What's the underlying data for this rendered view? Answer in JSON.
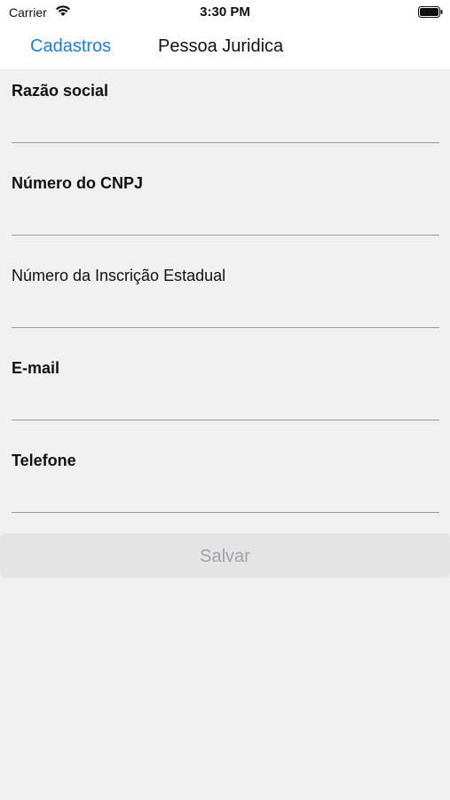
{
  "status_bar": {
    "carrier": "Carrier",
    "time": "3:30 PM",
    "icons": [
      "wifi-icon",
      "battery-icon"
    ]
  },
  "nav": {
    "back_label": "Cadastros",
    "title": "Pessoa Juridica",
    "back_color": "#1a7ee6"
  },
  "form": {
    "fields": [
      {
        "label": "Razão social",
        "value": ""
      },
      {
        "label": "Número do CNPJ",
        "value": ""
      },
      {
        "label": "Número da Inscrição Estadual",
        "value": ""
      },
      {
        "label": "E-mail",
        "value": ""
      },
      {
        "label": "Telefone",
        "value": ""
      }
    ],
    "save_label": "Salvar"
  }
}
